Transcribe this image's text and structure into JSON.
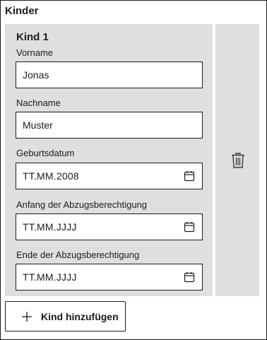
{
  "section": {
    "title": "Kinder"
  },
  "child": {
    "title": "Kind 1",
    "first_name": {
      "label": "Vorname",
      "value": "Jonas"
    },
    "last_name": {
      "label": "Nachname",
      "value": "Muster"
    },
    "birth_date": {
      "label": "Geburtsdatum",
      "value": "TT.MM.2008",
      "icon": "calendar-icon"
    },
    "deduction_start": {
      "label": "Anfang der Abzugsberechtigung",
      "value": "TT.MM.JJJJ",
      "icon": "calendar-icon"
    },
    "deduction_end": {
      "label": "Ende der Abzugsberechtigung",
      "value": "TT.MM.JJJJ",
      "icon": "calendar-icon"
    },
    "delete_icon": "trash-icon"
  },
  "actions": {
    "add_child_label": "Kind hinzufügen",
    "add_icon": "plus-icon"
  }
}
